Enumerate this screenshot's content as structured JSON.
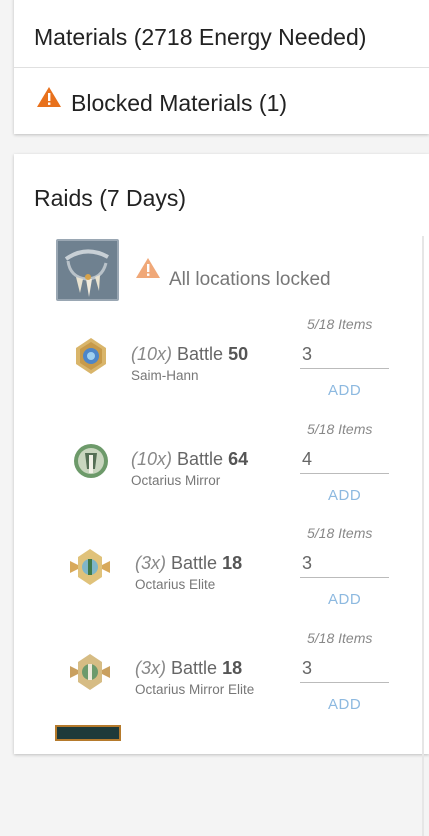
{
  "materials": {
    "title": "Materials (2718 Energy Needed)",
    "blocked_label": "Blocked Materials (1)"
  },
  "raids": {
    "title": "Raids (7 Days)",
    "locked_text": "All locations locked",
    "battles": [
      {
        "multiplier": "(10x)",
        "label": "Battle",
        "number": "50",
        "location": "Saim-Hann",
        "items": "5/18 Items",
        "quantity": "3",
        "add_label": "ADD"
      },
      {
        "multiplier": "(10x)",
        "label": "Battle",
        "number": "64",
        "location": "Octarius Mirror",
        "items": "5/18 Items",
        "quantity": "4",
        "add_label": "ADD"
      },
      {
        "multiplier": "(3x)",
        "label": "Battle",
        "number": "18",
        "location": "Octarius Elite",
        "items": "5/18 Items",
        "quantity": "3",
        "add_label": "ADD"
      },
      {
        "multiplier": "(3x)",
        "label": "Battle",
        "number": "18",
        "location": "Octarius Mirror Elite",
        "items": "5/18 Items",
        "quantity": "3",
        "add_label": "ADD"
      }
    ]
  },
  "colors": {
    "warning": "#e8711c",
    "warning_muted": "#f0a878",
    "add_link": "#8db9e0"
  },
  "icons": {
    "warning": "warning-triangle-icon",
    "material": "claw-necklace-icon",
    "medal": "battle-medal-icon"
  }
}
